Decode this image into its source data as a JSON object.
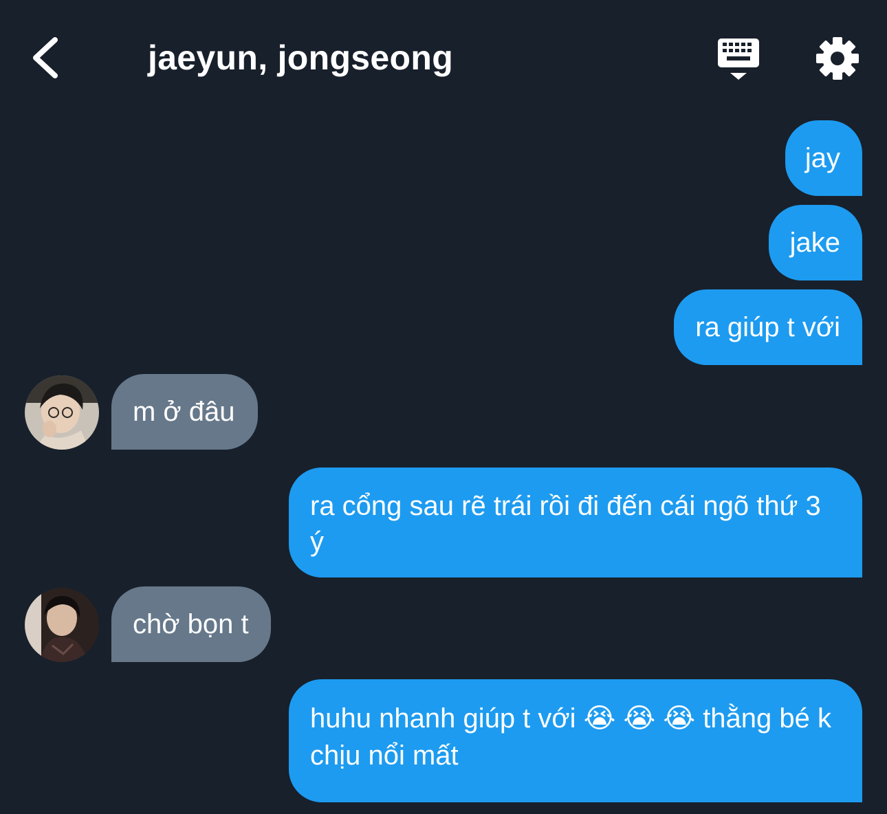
{
  "header": {
    "title": "jaeyun, jongseong",
    "back_icon": "chevron-left-icon",
    "keyboard_icon": "keyboard-hide-icon",
    "settings_icon": "gear-icon"
  },
  "colors": {
    "background": "#18202b",
    "outgoing_bubble": "#1d9bf0",
    "incoming_bubble": "#66788a",
    "text": "#ffffff"
  },
  "messages": [
    {
      "direction": "outgoing",
      "text": "jay"
    },
    {
      "direction": "outgoing",
      "text": "jake"
    },
    {
      "direction": "outgoing",
      "text": "ra giúp t với"
    },
    {
      "direction": "incoming",
      "avatar": "avatar-jaeyun",
      "text": "m ở đâu"
    },
    {
      "direction": "outgoing",
      "text": "ra cổng sau rẽ trái rồi đi đến cái ngõ thứ 3 ý"
    },
    {
      "direction": "incoming",
      "avatar": "avatar-jongseong",
      "text": "chờ bọn t"
    },
    {
      "direction": "outgoing",
      "text": "huhu nhanh giúp t với 😭 😭 😭  thằng bé k chịu nổi mất"
    }
  ]
}
